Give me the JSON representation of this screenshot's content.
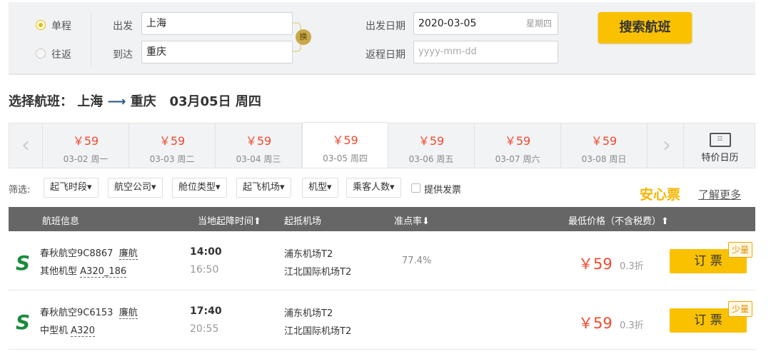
{
  "search": {
    "one_way": "单程",
    "round_trip": "往返",
    "depart_label": "出发",
    "arrive_label": "到达",
    "from": "上海",
    "to": "重庆",
    "swap": "换",
    "depart_date_label": "出发日期",
    "depart_date": "2020-03-05",
    "weekday": "星期四",
    "return_date_label": "返程日期",
    "return_placeholder": "yyyy-mm-dd",
    "search_button": "搜索航班"
  },
  "heading": {
    "prefix": "选择航班：",
    "from": "上海",
    "arrow": "⟶",
    "to": "重庆",
    "date": "03月05日 周四"
  },
  "dates": [
    {
      "price": "￥59",
      "date": "03-02 周一"
    },
    {
      "price": "￥59",
      "date": "03-03 周二"
    },
    {
      "price": "￥59",
      "date": "03-04 周三"
    },
    {
      "price": "￥59",
      "date": "03-05 周四"
    },
    {
      "price": "￥59",
      "date": "03-06 周五"
    },
    {
      "price": "￥59",
      "date": "03-07 周六"
    },
    {
      "price": "￥59",
      "date": "03-08 周日"
    }
  ],
  "calendar_label": "特价日历",
  "filters": {
    "label": "筛选:",
    "items": [
      "起飞时段▾",
      "航空公司▾",
      "舱位类型▾",
      "起飞机场▾",
      "机型▾",
      "乘客人数▾"
    ],
    "invoice": "提供发票",
    "anxin": "安心票",
    "learn_more": "了解更多"
  },
  "table": {
    "headers": [
      "航班信息",
      "当地起降时间⬆",
      "起抵机场",
      "准点率⬇",
      "最低价格（不含税费）⬆"
    ]
  },
  "flights": [
    {
      "airline": "春秋航空9C8867",
      "tag": "廉航",
      "plane_type": "其他机型",
      "plane": "A320_186",
      "dep": "14:00",
      "arr": "16:50",
      "from_airport": "浦东机场T2",
      "to_airport": "江北国际机场T2",
      "ontime": "77.4%",
      "price": "￥59",
      "discount": "0.3折",
      "book": "订 票",
      "badge": "少量"
    },
    {
      "airline": "春秋航空9C6153",
      "tag": "廉航",
      "plane_type": "中型机",
      "plane": "A320",
      "dep": "17:40",
      "arr": "20:55",
      "from_airport": "浦东机场T2",
      "to_airport": "江北国际机场T2",
      "ontime": "",
      "price": "￥59",
      "discount": "0.3折",
      "book": "订 票",
      "badge": "少量"
    }
  ]
}
